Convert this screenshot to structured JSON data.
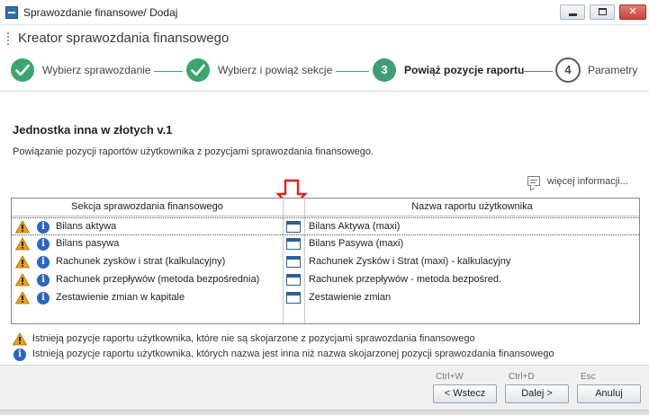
{
  "window": {
    "title": "Sprawozdanie finansowe/ Dodaj"
  },
  "wizard": {
    "title": "Kreator sprawozdania finansowego",
    "steps": [
      {
        "label": "Wybierz sprawozdanie",
        "state": "done"
      },
      {
        "label": "Wybierz i powiąż sekcje",
        "state": "done"
      },
      {
        "number": "3",
        "label": "Powiąż pozycje raportu",
        "state": "active"
      },
      {
        "number": "4",
        "label": "Parametry",
        "state": "todo"
      }
    ]
  },
  "content": {
    "title": "Jednostka inna w złotych v.1",
    "description": "Powiązanie pozycji raportów użytkownika z pozycjami sprawozdania finansowego.",
    "more_info": "więcej informacji..."
  },
  "grid": {
    "columns": [
      "Sekcja sprawozdania finansowego",
      "Nazwa raportu użytkownika"
    ],
    "rows": [
      {
        "section": "Bilans aktywa",
        "report": "Bilans Aktywa (maxi)"
      },
      {
        "section": "Bilans pasywa",
        "report": "Bilans Pasywa (maxi)"
      },
      {
        "section": "Rachunek zysków i strat (kalkulacyjny)",
        "report": "Rachunek Zysków i Strat (maxi) - kalkulacyjny"
      },
      {
        "section": "Rachunek przepływów (metoda bezpośrednia)",
        "report": "Rachunek przepływów - metoda bezpośred."
      },
      {
        "section": "Zestawienie zmian w kapitale",
        "report": "Zestawienie zmian"
      }
    ]
  },
  "legend": {
    "warning": "Istnieją pozycje raportu użytkownika, które nie są skojarzone z pozycjami sprawozdania finansowego",
    "info": "Istnieją pozycje raportu użytkownika, których nazwa jest inna niż nazwa skojarzonej pozycji sprawozdania finansowego"
  },
  "footer": {
    "back": {
      "shortcut": "Ctrl+W",
      "label": "< Wstecz"
    },
    "next": {
      "shortcut": "Ctrl+D",
      "label": "Dalej >"
    },
    "cancel": {
      "shortcut": "Esc",
      "label": "Anuluj"
    }
  },
  "colors": {
    "step_done": "#3aa66f",
    "info_icon": "#2b66c2",
    "warning_icon": "#e8a21a",
    "annotation_arrow": "#e02020"
  }
}
